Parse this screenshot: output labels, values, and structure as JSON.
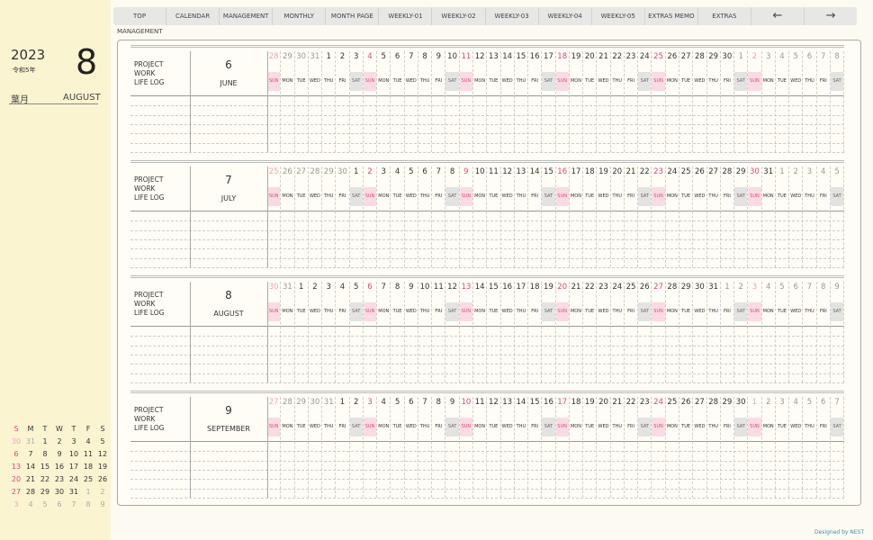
{
  "sidebar": {
    "year": "2023",
    "era": "令和5年",
    "month_number": "8",
    "jp_month": "葉月",
    "en_month": "AUGUST",
    "mini_calendar": {
      "weekday_headers": [
        "S",
        "M",
        "T",
        "W",
        "T",
        "F",
        "S"
      ],
      "weeks": [
        [
          {
            "d": "30",
            "dim": true
          },
          {
            "d": "31",
            "dim": true
          },
          {
            "d": "1"
          },
          {
            "d": "2"
          },
          {
            "d": "3"
          },
          {
            "d": "4"
          },
          {
            "d": "5"
          }
        ],
        [
          {
            "d": "6"
          },
          {
            "d": "7"
          },
          {
            "d": "8"
          },
          {
            "d": "9"
          },
          {
            "d": "10"
          },
          {
            "d": "11"
          },
          {
            "d": "12"
          }
        ],
        [
          {
            "d": "13"
          },
          {
            "d": "14"
          },
          {
            "d": "15"
          },
          {
            "d": "16"
          },
          {
            "d": "17"
          },
          {
            "d": "18"
          },
          {
            "d": "19"
          }
        ],
        [
          {
            "d": "20"
          },
          {
            "d": "21"
          },
          {
            "d": "22"
          },
          {
            "d": "23"
          },
          {
            "d": "24"
          },
          {
            "d": "25"
          },
          {
            "d": "26"
          }
        ],
        [
          {
            "d": "27"
          },
          {
            "d": "28"
          },
          {
            "d": "29"
          },
          {
            "d": "30"
          },
          {
            "d": "31"
          },
          {
            "d": "1",
            "dim": true
          },
          {
            "d": "2",
            "dim": true
          }
        ],
        [
          {
            "d": "3",
            "dim": true
          },
          {
            "d": "4",
            "dim": true
          },
          {
            "d": "5",
            "dim": true
          },
          {
            "d": "6",
            "dim": true
          },
          {
            "d": "7",
            "dim": true
          },
          {
            "d": "8",
            "dim": true
          },
          {
            "d": "9",
            "dim": true
          }
        ]
      ]
    }
  },
  "nav": {
    "items": [
      "TOP",
      "CALENDAR",
      "MANAGEMENT",
      "MONTHLY",
      "MONTH PAGE",
      "WEEKLY-01",
      "WEEKLY-02",
      "WEEKLY-03",
      "WEEKLY-04",
      "WEEKLY-05",
      "EXTRAS MEMO",
      "EXTRAS"
    ],
    "prev": "←",
    "next": "→"
  },
  "breadcrumb": "MANAGEMENT",
  "categories": [
    "PROJECT",
    "WORK",
    "LIFE LOG"
  ],
  "weekday_labels": [
    "SUN",
    "MON",
    "TUE",
    "WED",
    "THU",
    "FRI",
    "SAT"
  ],
  "months": [
    {
      "number": "6",
      "name": "JUNE",
      "first_weekday": 0,
      "days": [
        "28",
        "29",
        "30",
        "31",
        "1",
        "2",
        "3",
        "4",
        "5",
        "6",
        "7",
        "8",
        "9",
        "10",
        "11",
        "12",
        "13",
        "14",
        "15",
        "16",
        "17",
        "18",
        "19",
        "20",
        "21",
        "22",
        "23",
        "24",
        "25",
        "26",
        "27",
        "28",
        "29",
        "30",
        "1",
        "2",
        "3",
        "4",
        "5",
        "6",
        "7",
        "8"
      ],
      "dim_before": 4,
      "dim_after": 8
    },
    {
      "number": "7",
      "name": "JULY",
      "first_weekday": 0,
      "days": [
        "25",
        "26",
        "27",
        "28",
        "29",
        "30",
        "1",
        "2",
        "3",
        "4",
        "5",
        "6",
        "7",
        "8",
        "9",
        "10",
        "11",
        "12",
        "13",
        "14",
        "15",
        "16",
        "17",
        "18",
        "19",
        "20",
        "21",
        "22",
        "23",
        "24",
        "25",
        "26",
        "27",
        "28",
        "29",
        "30",
        "31",
        "1",
        "2",
        "3",
        "4",
        "5"
      ],
      "dim_before": 6,
      "dim_after": 5
    },
    {
      "number": "8",
      "name": "AUGUST",
      "first_weekday": 0,
      "days": [
        "30",
        "31",
        "1",
        "2",
        "3",
        "4",
        "5",
        "6",
        "7",
        "8",
        "9",
        "10",
        "11",
        "12",
        "13",
        "14",
        "15",
        "16",
        "17",
        "18",
        "19",
        "20",
        "21",
        "22",
        "23",
        "24",
        "25",
        "26",
        "27",
        "28",
        "29",
        "30",
        "31",
        "1",
        "2",
        "3",
        "4",
        "5",
        "6",
        "7",
        "8",
        "9"
      ],
      "dim_before": 2,
      "dim_after": 9
    },
    {
      "number": "9",
      "name": "SEPTEMBER",
      "first_weekday": 0,
      "days": [
        "27",
        "28",
        "29",
        "30",
        "31",
        "1",
        "2",
        "3",
        "4",
        "5",
        "6",
        "7",
        "8",
        "9",
        "10",
        "11",
        "12",
        "13",
        "14",
        "15",
        "16",
        "17",
        "18",
        "19",
        "20",
        "21",
        "22",
        "23",
        "24",
        "25",
        "26",
        "27",
        "28",
        "29",
        "30",
        "1",
        "2",
        "3",
        "4",
        "5",
        "6",
        "7"
      ],
      "dim_before": 5,
      "dim_after": 7
    }
  ],
  "credit": "Designed by NEST",
  "colors": {
    "sunday": "#e0457b",
    "saturday_bg": "#e3e3e1",
    "sunday_bg": "#f9dbe3",
    "sidebar_bg": "#fbf4d1"
  }
}
